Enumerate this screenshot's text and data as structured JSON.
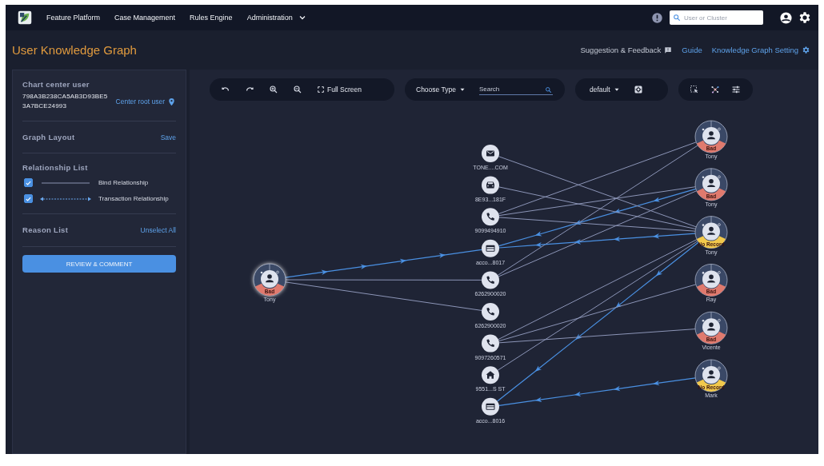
{
  "nav": {
    "items": [
      {
        "label": "Feature Platform"
      },
      {
        "label": "Case Management"
      },
      {
        "label": "Rules Engine"
      },
      {
        "label": "Administration",
        "kind": "dropdown"
      }
    ],
    "search_placeholder": "User or Cluster"
  },
  "page": {
    "title": "User Knowledge Graph",
    "links": [
      {
        "label": "Suggestion & Feedback",
        "kind": "feedback"
      },
      {
        "label": "Guide",
        "kind": "plain"
      },
      {
        "label": "Knowledge Graph Setting",
        "kind": "settings"
      }
    ]
  },
  "sidebar": {
    "center_user": {
      "heading": "Chart center user",
      "user_id": "798A3B238CA5AB3D93BE53A7BCE24993",
      "action": "Center root user"
    },
    "graph_layout": {
      "heading": "Graph Layout",
      "action": "Save"
    },
    "relationships": {
      "heading": "Relationship List",
      "items": [
        {
          "label": "Bind Relationship",
          "kind": "bind",
          "checked": true
        },
        {
          "label": "Transaction Relationship",
          "kind": "transaction",
          "checked": true
        }
      ]
    },
    "reasons": {
      "heading": "Reason List",
      "action": "Unselect All"
    },
    "review_button": "REVIEW & COMMENT"
  },
  "toolbar": {
    "full_screen": "Full Screen",
    "type_select": "Choose Type",
    "search_placeholder": "Search",
    "layout_select": "default"
  },
  "graph": {
    "center_user": {
      "label": "Tony",
      "badge": "Bad",
      "color": "#e07a6e",
      "links": [
        {
          "kind": "none"
        },
        {
          "kind": "none"
        },
        {
          "kind": "none"
        },
        {
          "kind": "transaction"
        },
        {
          "kind": "bind"
        },
        {
          "kind": "bind"
        },
        {
          "kind": "none"
        },
        {
          "kind": "none"
        },
        {
          "kind": "none"
        }
      ]
    },
    "entities": [
      {
        "kind": "email",
        "label": "TONE....COM"
      },
      {
        "kind": "device",
        "label": "8E93...181F"
      },
      {
        "kind": "phone",
        "label": "9099494910"
      },
      {
        "kind": "account",
        "label": "acco...8017"
      },
      {
        "kind": "phone",
        "label": "6262900020"
      },
      {
        "kind": "phone",
        "label": "6262900020"
      },
      {
        "kind": "phone",
        "label": "9097260571"
      },
      {
        "kind": "address",
        "label": "9551...S ST"
      },
      {
        "kind": "account",
        "label": "acco...8016"
      }
    ],
    "related_users": [
      {
        "label": "Tony",
        "badge": "Bad",
        "color": "#e07a6e",
        "links": [
          {
            "kind": "none"
          },
          {
            "kind": "none"
          },
          {
            "kind": "bind"
          },
          {
            "kind": "none"
          },
          {
            "kind": "bind"
          },
          {
            "kind": "none"
          },
          {
            "kind": "none"
          },
          {
            "kind": "none"
          },
          {
            "kind": "none"
          }
        ]
      },
      {
        "label": "Tony",
        "badge": "Bad",
        "color": "#e07a6e",
        "links": [
          {
            "kind": "none"
          },
          {
            "kind": "none"
          },
          {
            "kind": "bind"
          },
          {
            "kind": "transaction"
          },
          {
            "kind": "bind"
          },
          {
            "kind": "none"
          },
          {
            "kind": "none"
          },
          {
            "kind": "none"
          },
          {
            "kind": "none"
          }
        ]
      },
      {
        "label": "Tony",
        "badge": "No Record",
        "color": "#f2c94c",
        "links": [
          {
            "kind": "bind"
          },
          {
            "kind": "bind"
          },
          {
            "kind": "bind"
          },
          {
            "kind": "transaction"
          },
          {
            "kind": "none"
          },
          {
            "kind": "none"
          },
          {
            "kind": "bind"
          },
          {
            "kind": "bind"
          },
          {
            "kind": "transaction"
          }
        ]
      },
      {
        "label": "Ray",
        "badge": "Bad",
        "color": "#e07a6e",
        "links": [
          {
            "kind": "none"
          },
          {
            "kind": "none"
          },
          {
            "kind": "none"
          },
          {
            "kind": "none"
          },
          {
            "kind": "none"
          },
          {
            "kind": "none"
          },
          {
            "kind": "bind"
          },
          {
            "kind": "none"
          },
          {
            "kind": "none"
          }
        ]
      },
      {
        "label": "Vicente",
        "badge": "Bad",
        "color": "#e07a6e",
        "links": [
          {
            "kind": "none"
          },
          {
            "kind": "none"
          },
          {
            "kind": "none"
          },
          {
            "kind": "none"
          },
          {
            "kind": "none"
          },
          {
            "kind": "none"
          },
          {
            "kind": "bind"
          },
          {
            "kind": "none"
          },
          {
            "kind": "none"
          }
        ]
      },
      {
        "label": "Mark",
        "badge": "No Record",
        "color": "#f2c94c",
        "links": [
          {
            "kind": "none"
          },
          {
            "kind": "none"
          },
          {
            "kind": "none"
          },
          {
            "kind": "none"
          },
          {
            "kind": "none"
          },
          {
            "kind": "none"
          },
          {
            "kind": "none"
          },
          {
            "kind": "none"
          },
          {
            "kind": "transaction"
          }
        ]
      }
    ]
  }
}
